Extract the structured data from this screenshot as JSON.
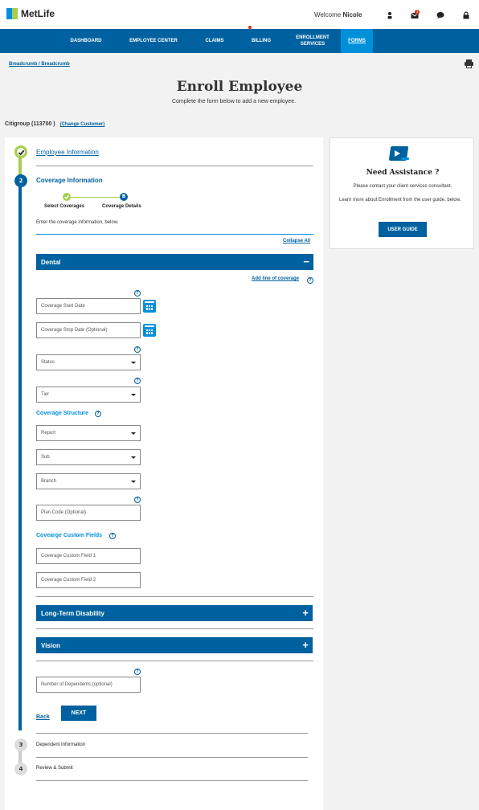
{
  "header": {
    "logo_text": "MetLife",
    "welcome_prefix": "Welcome",
    "user_name": "Nicole",
    "messages_badge": "3"
  },
  "nav": {
    "items": [
      "DASHBOARD",
      "EMPLOYEE CENTER",
      "CLAIMS",
      "BILLING",
      "ENROLLMENT SERVICES",
      "FORMS"
    ],
    "active": "FORMS"
  },
  "breadcrumb": "Breadcrumb / Breadcrumb",
  "page": {
    "title": "Enroll Employee",
    "subtitle": "Complete the form below to add a new employee."
  },
  "customer": {
    "name": "Citigroup (113700 )",
    "change_link": "(Change Customer)"
  },
  "steps": {
    "step1_label": "Employee Information",
    "step2_number": "2",
    "step2_label": "Coverage Information",
    "step3_number": "3",
    "step3_label": "Dependent Information",
    "step4_number": "4",
    "step4_label": "Review & Submit"
  },
  "substeps": {
    "select_coverages": "Select Coverages",
    "coverage_details": "Coverage Details",
    "coverage_details_letter": "B"
  },
  "form": {
    "info_text": "Enter the coverage information, below.",
    "collapse_all": "Collapse All",
    "dental": {
      "title": "Dental",
      "add_line": "Add line of coverage",
      "start_date": "Coverage Start Date",
      "stop_date": "Coverage Stop Date (Optional)",
      "status": "Status",
      "tier": "Tier",
      "structure_label": "Coverage Structure",
      "report": "Report",
      "sub": "Sub",
      "branch": "Branch",
      "plan_code": "Plan Code (Optional)",
      "custom_fields_label": "Covearge Custom Fields",
      "custom_field_1": "Coverage Custom Field 1",
      "custom_field_2": "Coverage Custom Field 2"
    },
    "ltd_title": "Long-Term Disability",
    "vision_title": "Vision",
    "dependents": "Number of Dependents (optional)",
    "back": "Back",
    "next": "NEXT"
  },
  "assistance": {
    "title": "Need Assistance ?",
    "line1": "Please contact your client services consultant.",
    "line2": "Learn more about Enrollment from the user guide, below.",
    "button": "USER GUIDE"
  },
  "colors": {
    "primary": "#0061a0",
    "accent": "#0090da",
    "success": "#a4ce4e",
    "alert": "#d42e12"
  }
}
